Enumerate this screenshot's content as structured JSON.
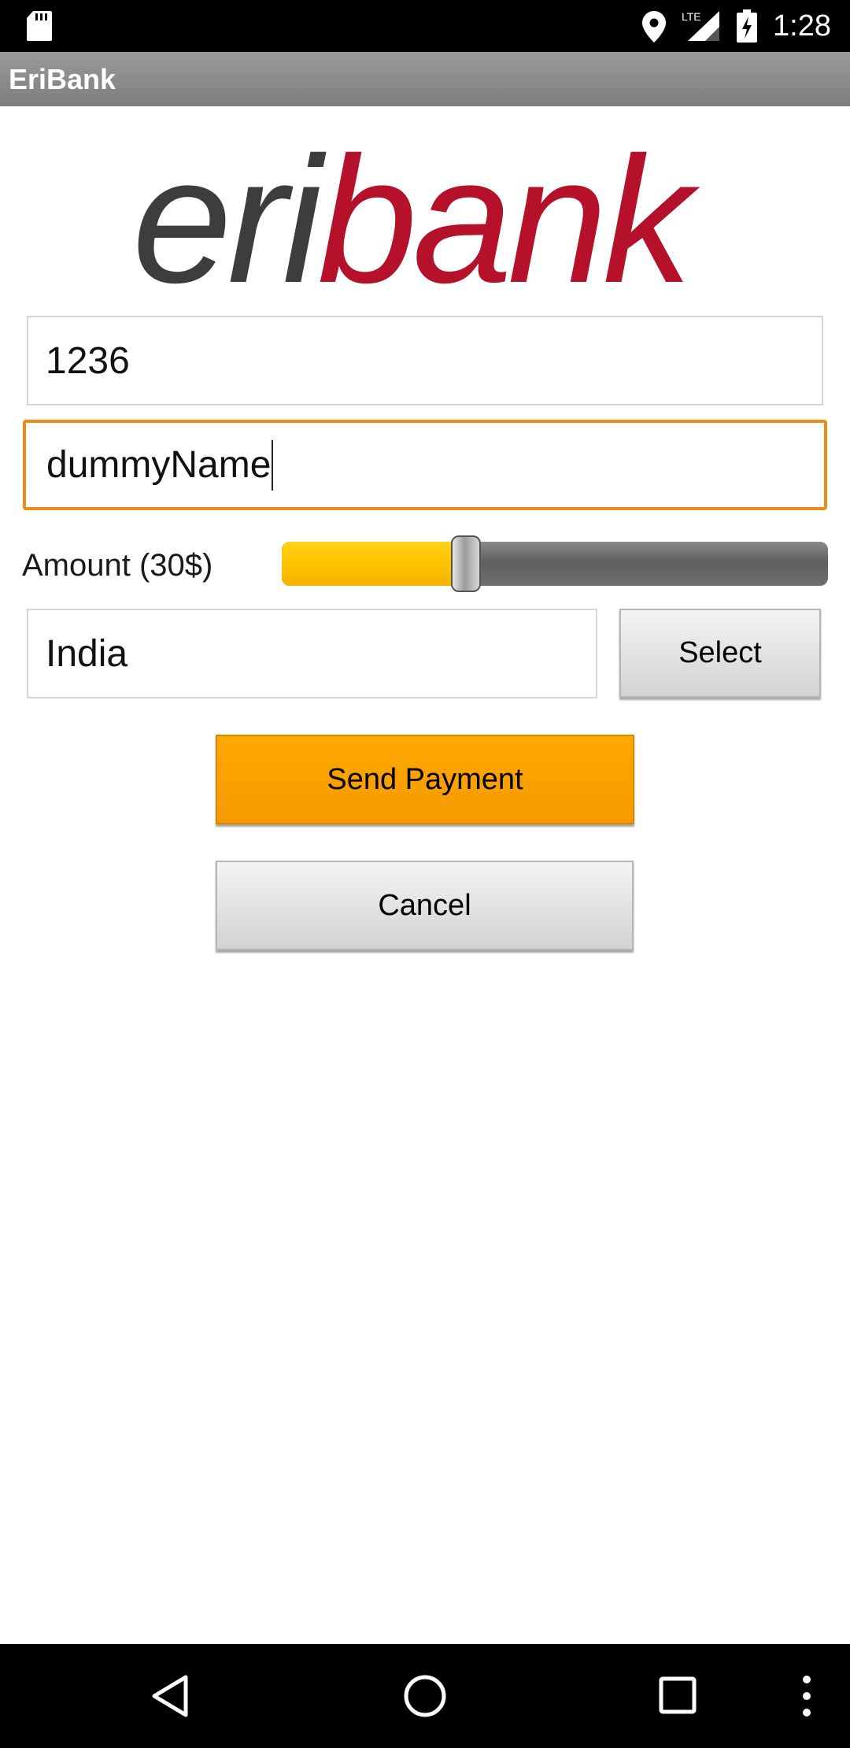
{
  "status_bar": {
    "time": "1:28",
    "network": "LTE",
    "icons": [
      "sd-card-icon",
      "location-icon",
      "signal-icon",
      "battery-charging-icon"
    ]
  },
  "app": {
    "title": "EriBank",
    "logo": {
      "part1": "eri",
      "part2": "bank",
      "color_dark": "#3d3d3d",
      "color_red": "#b5112a"
    }
  },
  "form": {
    "account_value": "1236",
    "name_value": "dummyName",
    "amount_label": "Amount (30$)",
    "amount_fraction": 0.31,
    "country_value": "India",
    "select_label": "Select",
    "send_label": "Send Payment",
    "cancel_label": "Cancel"
  },
  "colors": {
    "focus_border": "#f08a16",
    "send_button": "#ffa500",
    "slider_fill": "#ffc400"
  },
  "nav_bar": {
    "icons": [
      "back-icon",
      "home-icon",
      "recents-icon",
      "overflow-icon"
    ]
  }
}
